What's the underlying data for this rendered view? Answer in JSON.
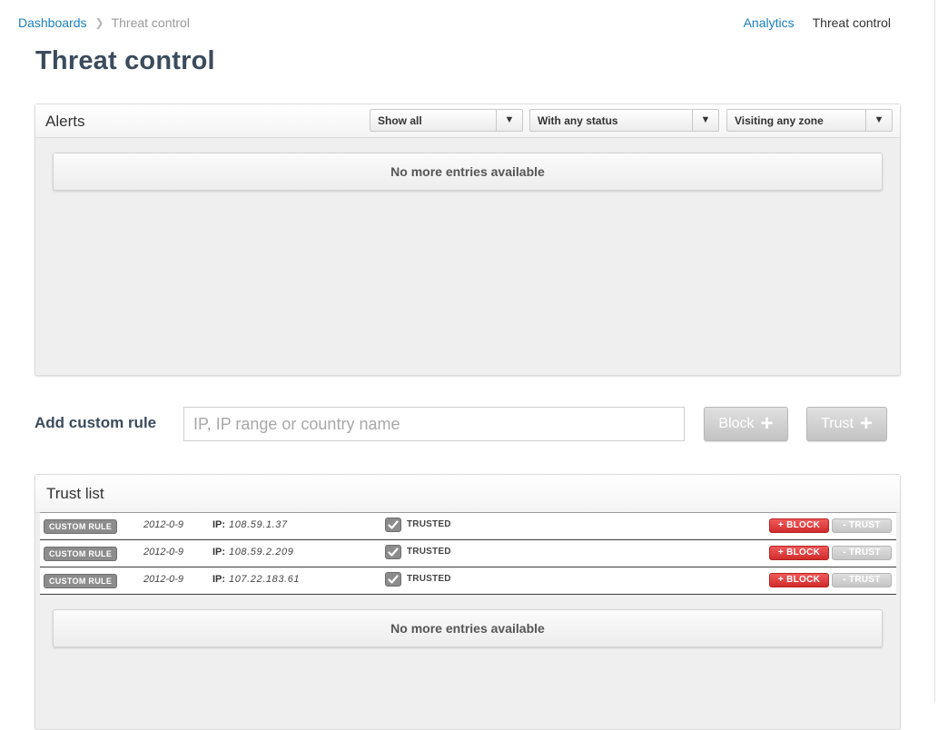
{
  "breadcrumb": {
    "root": "Dashboards",
    "current": "Threat control"
  },
  "topnav": {
    "analytics": "Analytics",
    "threat_control": "Threat control"
  },
  "page": {
    "title": "Threat control"
  },
  "alerts": {
    "title": "Alerts",
    "filters": [
      {
        "selected": "Show all"
      },
      {
        "selected": "With any status"
      },
      {
        "selected": "Visiting any zone"
      }
    ],
    "empty_text": "No more entries available"
  },
  "custom_rule": {
    "label": "Add custom rule",
    "placeholder": "IP, IP range or country name",
    "block_label": "Block",
    "trust_label": "Trust"
  },
  "trust_list": {
    "title": "Trust list",
    "rows": [
      {
        "badge": "CUSTOM RULE",
        "date": "2012-0-9",
        "ip_label": "IP:",
        "ip": "108.59.1.37",
        "status": "TRUSTED",
        "block": "+ BLOCK",
        "trust": "- TRUST"
      },
      {
        "badge": "CUSTOM RULE",
        "date": "2012-0-9",
        "ip_label": "IP:",
        "ip": "108.59.2.209",
        "status": "TRUSTED",
        "block": "+ BLOCK",
        "trust": "- TRUST"
      },
      {
        "badge": "CUSTOM RULE",
        "date": "2012-0-9",
        "ip_label": "IP:",
        "ip": "107.22.183.61",
        "status": "TRUSTED",
        "block": "+ BLOCK",
        "trust": "- TRUST"
      }
    ],
    "empty_text": "No more entries available"
  },
  "colors": {
    "link": "#1a7fc1",
    "danger": "#d12c2c",
    "heading": "#3b4b5b"
  },
  "icons": {
    "breadcrumb_separator": "chevron-right-icon",
    "dropdown": "triangle-down-icon",
    "add": "plus-icon",
    "trusted": "check-icon"
  }
}
